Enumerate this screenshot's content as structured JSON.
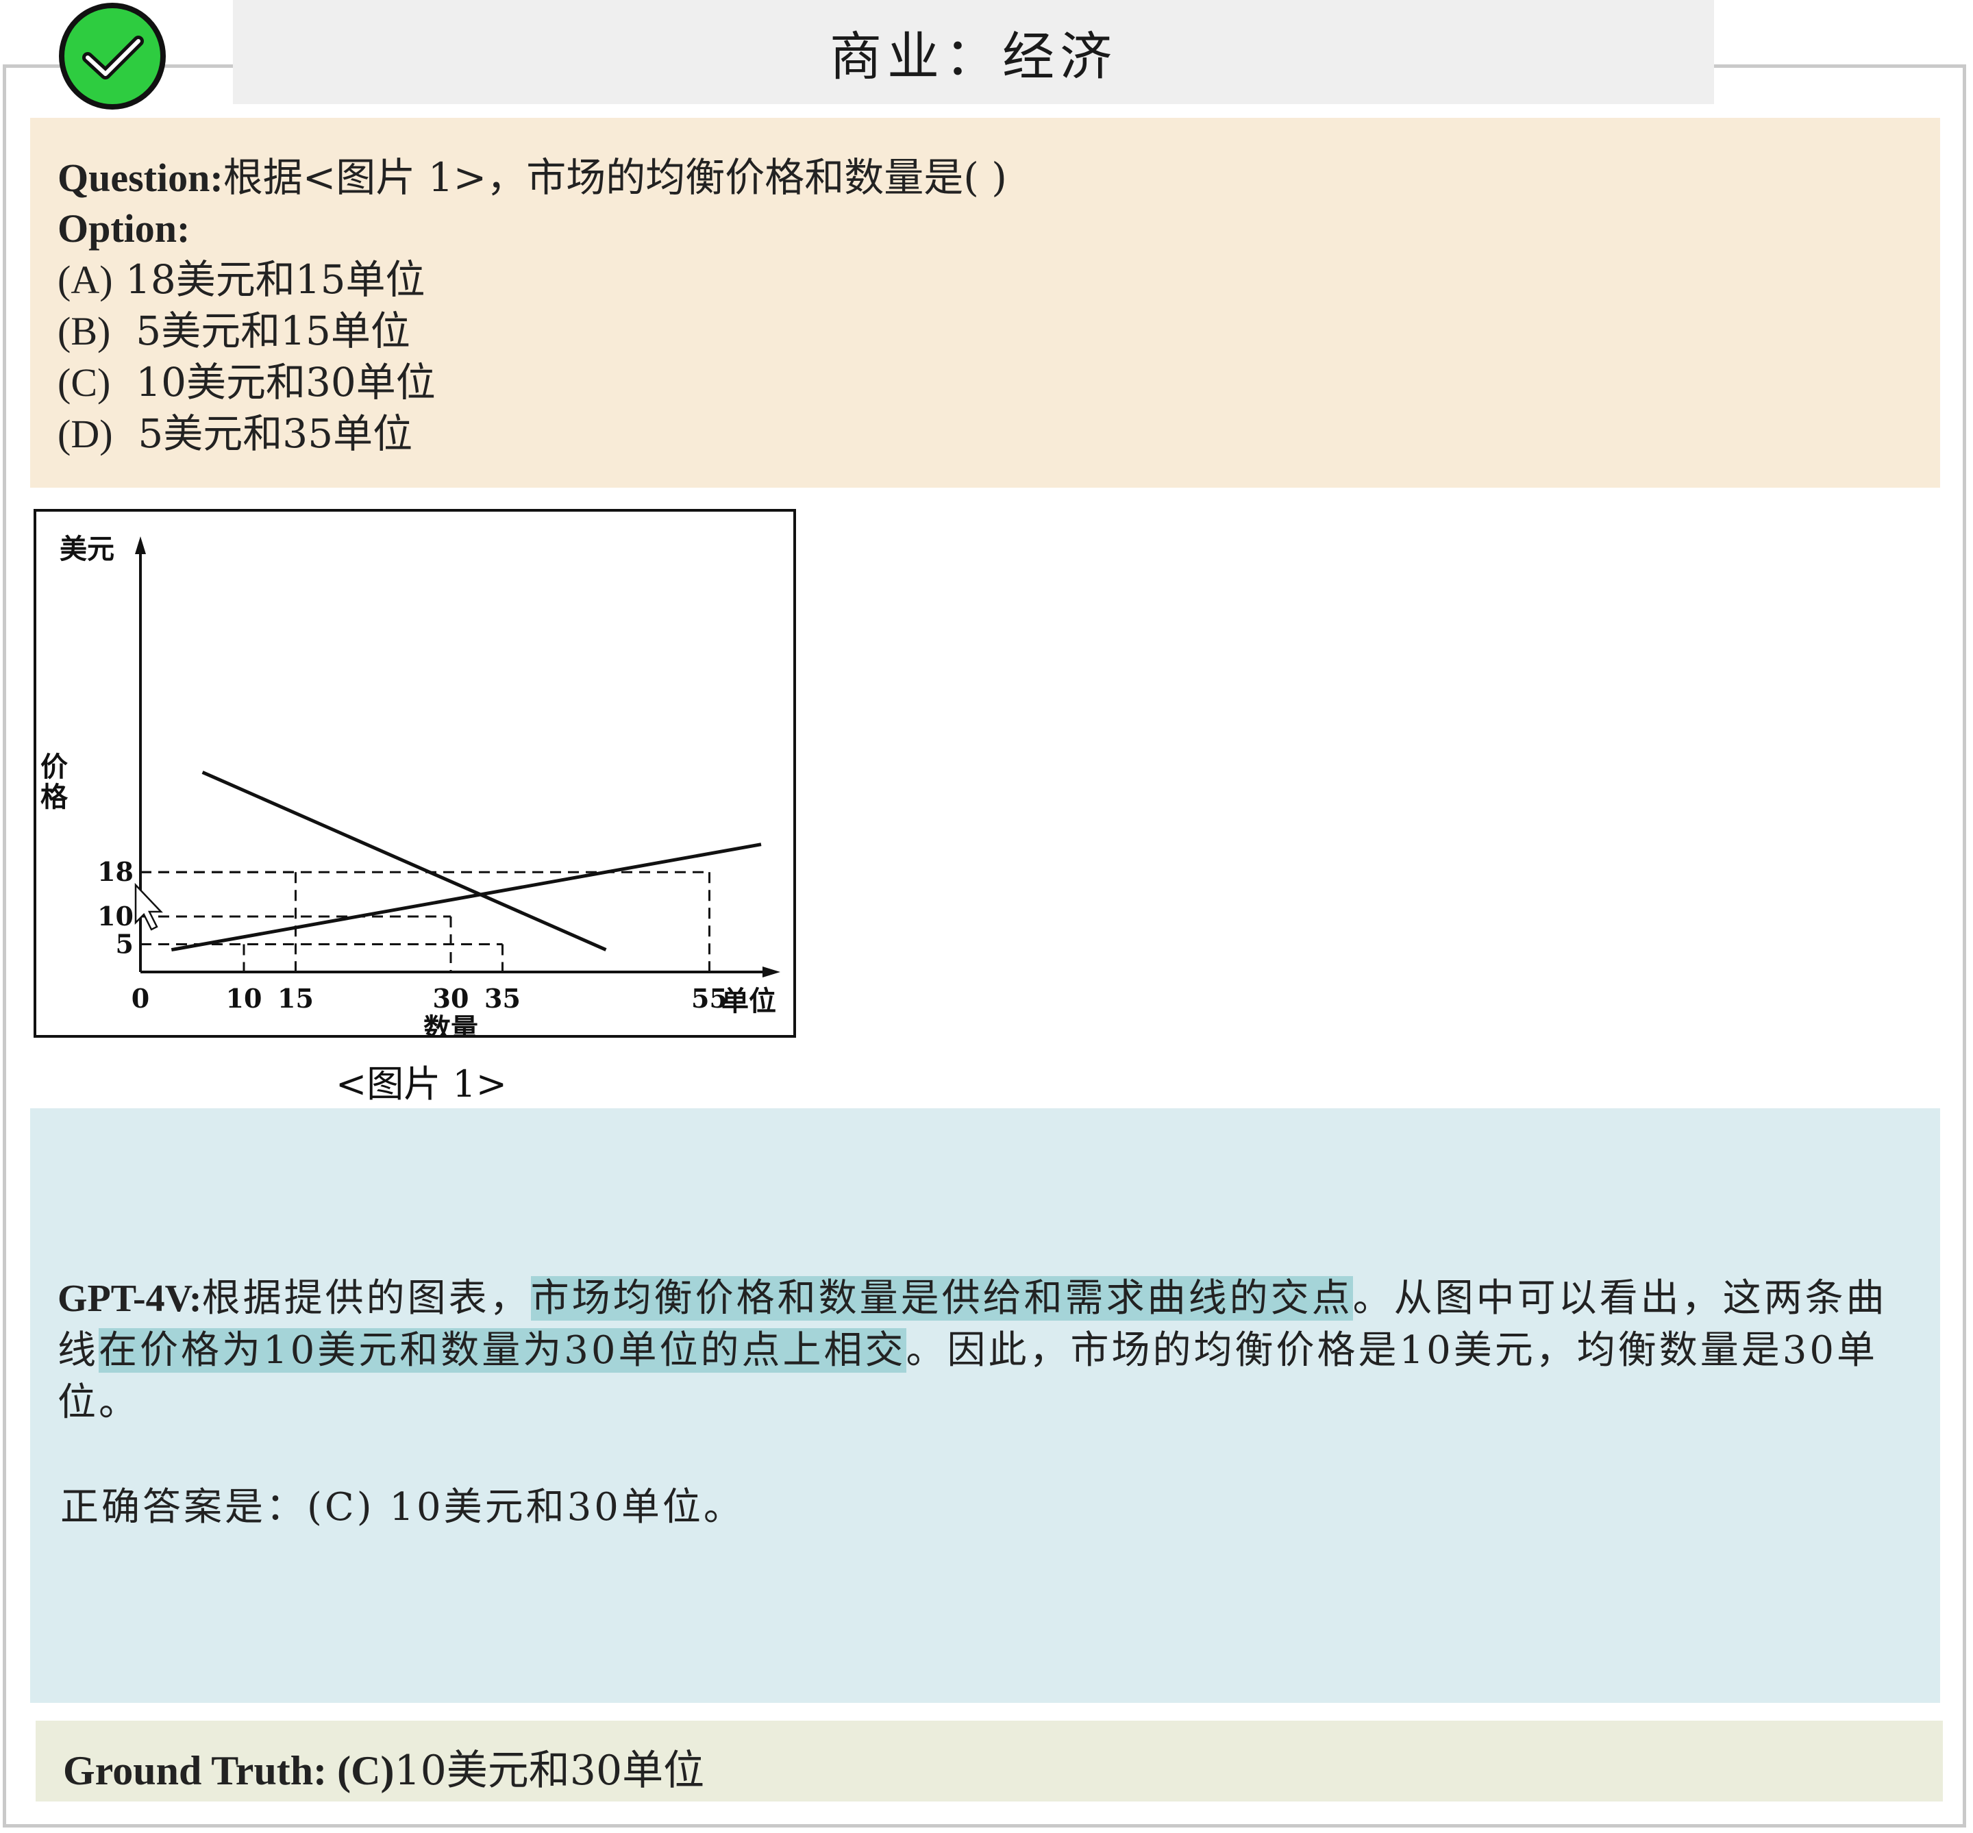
{
  "header": {
    "title": "商业：经济",
    "status_icon": "check-circle-icon",
    "status_color": "#2ecc40"
  },
  "question": {
    "label": "Question:",
    "text": "根据<图片 1>，市场的均衡价格和数量是( )",
    "option_label": "Option:",
    "options": [
      {
        "letter": "(A)",
        "text": " 18美元和15单位"
      },
      {
        "letter": "(B)",
        "text": "  5美元和15单位"
      },
      {
        "letter": "(C)",
        "text": "  10美元和30单位"
      },
      {
        "letter": "(D)",
        "text": "  5美元和35单位"
      }
    ]
  },
  "figure": {
    "caption": "<图片 1>"
  },
  "chart_data": {
    "type": "line",
    "ylabel_top": "美元",
    "ylabel_side": "价格",
    "xlabel_right": "单位",
    "xlabel_bottom": "数量",
    "origin_label": "0",
    "x_ticks": [
      "10",
      "15",
      "30",
      "35",
      "55"
    ],
    "y_ticks": [
      "5",
      "10",
      "18"
    ],
    "series": [
      {
        "points": [
          [
            6,
            36
          ],
          [
            45,
            4
          ]
        ]
      },
      {
        "points": [
          [
            3,
            4
          ],
          [
            60,
            23
          ]
        ]
      }
    ],
    "guides": [
      {
        "x": 15,
        "y": 18
      },
      {
        "x": 55,
        "y": 18
      },
      {
        "x": 30,
        "y": 10
      },
      {
        "x": 10,
        "y": 5
      },
      {
        "x": 35,
        "y": 5
      }
    ],
    "xlim": [
      0,
      64
    ],
    "ylim": [
      0,
      34
    ]
  },
  "answer": {
    "label": "GPT-4V:",
    "part1": "根据提供的图表，",
    "hl1": "市场均衡价格和数量是供给和需求曲线的交点",
    "part2": "。从图中可以看出，这两条曲线",
    "hl2": "在价格为10美元和数量为30单位的点上相交",
    "part3": "。因此，市场的均衡价格是10美元，均衡数量是30单位。",
    "final": "正确答案是：(C) 10美元和30单位。",
    "highlight_color": "#a5d4d8"
  },
  "ground_truth": {
    "label": "Ground Truth: (C)",
    "value": "10美元和30单位"
  }
}
